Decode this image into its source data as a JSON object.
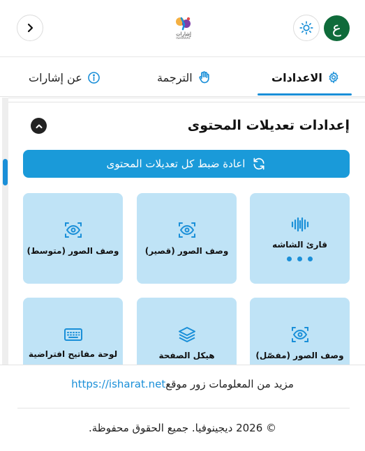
{
  "header": {
    "lang_label": "ع",
    "theme_icon": "sun-icon",
    "logo_text": "إشارات",
    "logo_sub": "ISHARAT",
    "back_icon": "chevron-right-icon"
  },
  "tabs": [
    {
      "label": "الاعدادات",
      "icon": "gear-icon",
      "active": true
    },
    {
      "label": "الترجمة",
      "icon": "hand-icon",
      "active": false
    },
    {
      "label": "عن إشارات",
      "icon": "info-icon",
      "active": false
    }
  ],
  "section": {
    "title": "إعدادات تعديلات المحتوى",
    "reset_label": "اعادة ضبط كل تعديلات المحتوى"
  },
  "cards": [
    {
      "label": "قارئ الشاشه",
      "icon": "soundwave-icon",
      "has_dots": true
    },
    {
      "label": "وصف الصور (قصير)",
      "icon": "eye-scan-icon"
    },
    {
      "label": "وصف الصور (متوسط)",
      "icon": "eye-scan-icon"
    },
    {
      "label": "وصف الصور (مفصّل)",
      "icon": "eye-scan-icon"
    },
    {
      "label": "هيكل الصفحة",
      "icon": "layers-icon"
    },
    {
      "label": "لوحة مفاتيح افتراضية",
      "icon": "keyboard-icon"
    }
  ],
  "footer": {
    "more_info": "مزيد من المعلومات زور موقع",
    "link": "https://isharat.net",
    "copyright": "© 2026 ديجينوفيا. جميع الحقوق محفوظة."
  },
  "colors": {
    "accent": "#1a9ad9",
    "card_bg": "#bfe3f6",
    "lang_btn": "#0f6b3a"
  }
}
